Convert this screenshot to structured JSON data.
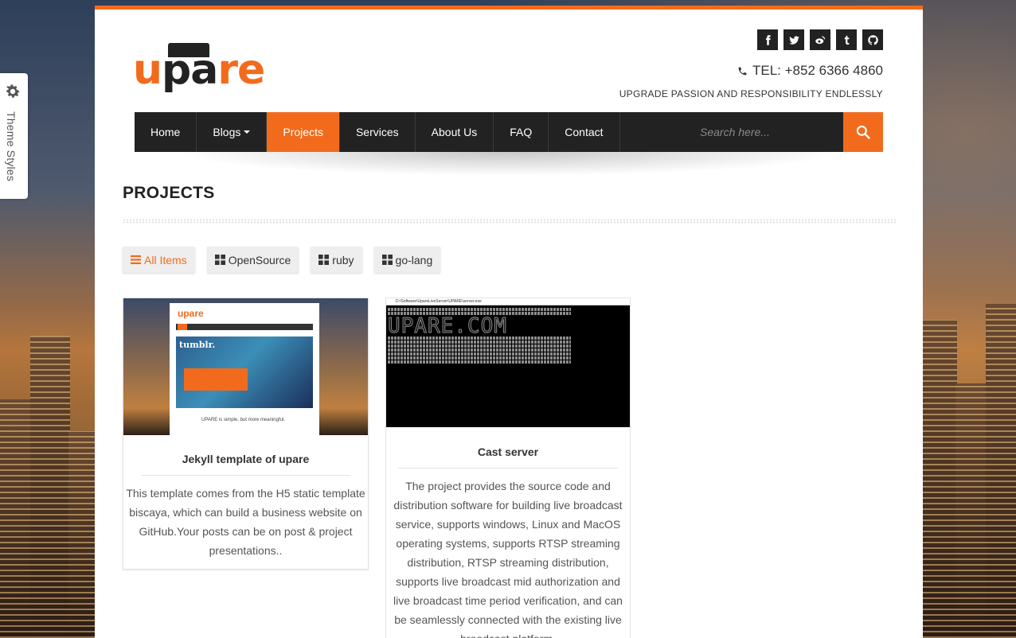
{
  "sidebar_tab": {
    "label": "Theme Styles",
    "icon": "gear-icon"
  },
  "header": {
    "logo_text_left": "u",
    "logo_text_mid": "pa",
    "logo_text_right": "re",
    "tel": "TEL: +852 6366 4860",
    "tagline": "UPGRADE PASSION AND RESPONSIBILITY ENDLESSLY",
    "social": [
      "facebook-icon",
      "twitter-icon",
      "weibo-icon",
      "tumblr-icon",
      "github-icon"
    ]
  },
  "nav": {
    "items": [
      {
        "label": "Home"
      },
      {
        "label": "Blogs"
      },
      {
        "label": "Projects"
      },
      {
        "label": "Services"
      },
      {
        "label": "About Us"
      },
      {
        "label": "FAQ"
      },
      {
        "label": "Contact"
      }
    ],
    "active": "Projects",
    "search_placeholder": "Search here..."
  },
  "main": {
    "title": "PROJECTS",
    "filters": [
      {
        "label": "All Items",
        "icon": "list-icon"
      },
      {
        "label": "OpenSource",
        "icon": "grid-icon"
      },
      {
        "label": "ruby",
        "icon": "grid-icon"
      },
      {
        "label": "go-lang",
        "icon": "grid-icon"
      }
    ],
    "projects": [
      {
        "title": "Jekyll template of upare",
        "description": "This template comes from the H5 static template biscaya, which can build a business website on GitHub.Your posts can be on post & project presentations..",
        "thumb_logo": "upare",
        "thumb_hero": "tumblr.",
        "thumb_caption": "UPARE is simple, but more meaningful."
      },
      {
        "title": "Cast server",
        "description": "The project provides the source code and distribution software for building live broadcast service, supports windows, Linux and MacOS operating systems, supports RTSP streaming distribution, RTSP streaming distribution, supports live broadcast mid authorization and live broadcast time period verification, and can be seamlessly connected with the existing live broadcast platform.",
        "thumb_window_title": "D:\\Software\\UpareLiveServer\\UPARE\\server.exe",
        "thumb_banner": "UPARE.COM"
      }
    ]
  },
  "colors": {
    "accent": "#f26b1d",
    "nav_bg": "#222222"
  }
}
